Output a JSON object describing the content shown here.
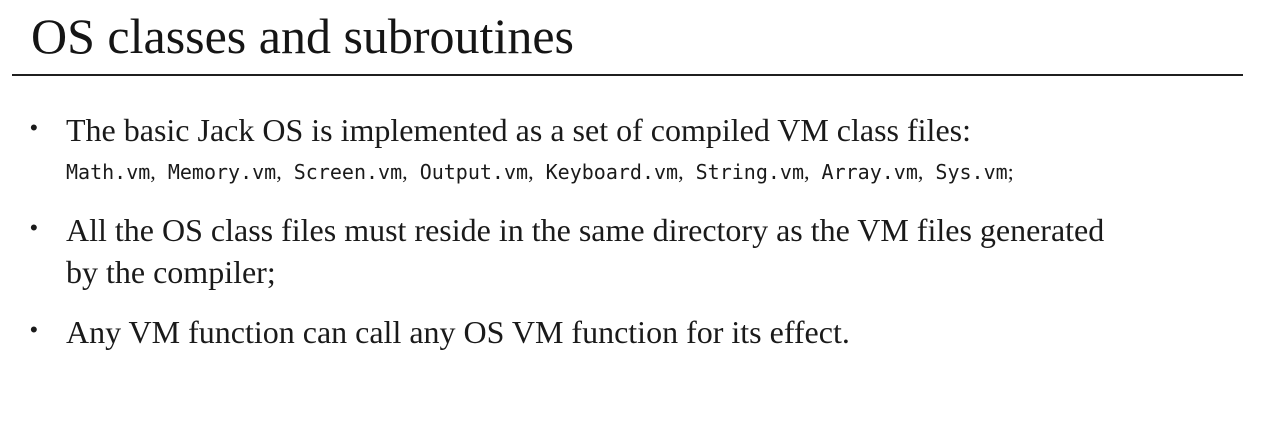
{
  "slide": {
    "title": "OS classes and subroutines",
    "bullets": [
      {
        "text": "The basic Jack OS is implemented as a set of compiled VM class files:",
        "code_files": [
          "Math.vm",
          "Memory.vm",
          "Screen.vm",
          "Output.vm",
          "Keyboard.vm",
          "String.vm",
          "Array.vm",
          "Sys.vm"
        ],
        "code_separator": ",",
        "code_terminator": ";"
      },
      {
        "line1": "All the OS class files must reside in the same directory as the VM files generated",
        "line2": "by the compiler;"
      },
      {
        "text": "Any VM function can call any OS VM function for its effect."
      }
    ]
  }
}
